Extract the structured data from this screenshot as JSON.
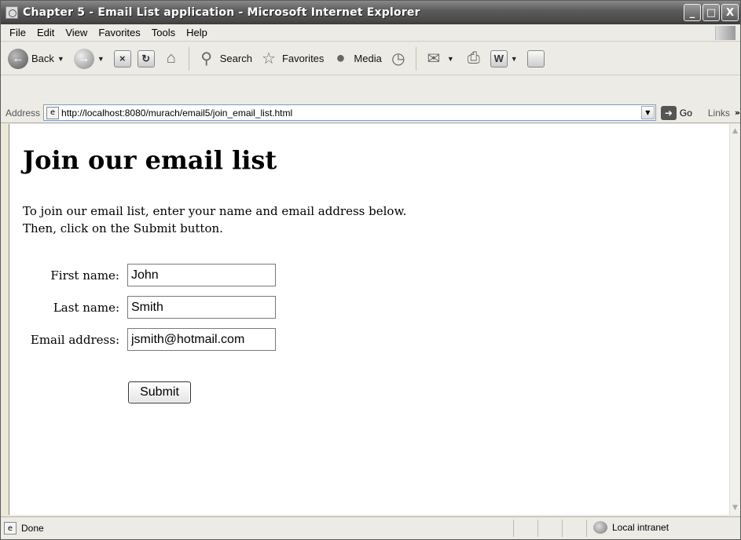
{
  "window": {
    "title": "Chapter 5 - Email List application - Microsoft Internet Explorer",
    "controls": {
      "minimize": "_",
      "maximize": "□",
      "close": "X"
    }
  },
  "menu": {
    "items": [
      {
        "label": "File"
      },
      {
        "label": "Edit"
      },
      {
        "label": "View"
      },
      {
        "label": "Favorites"
      },
      {
        "label": "Tools"
      },
      {
        "label": "Help"
      }
    ]
  },
  "toolbar": {
    "back_label": "Back",
    "search_label": "Search",
    "favorites_label": "Favorites",
    "media_label": "Media",
    "icons": {
      "back": "back-arrow-icon",
      "forward": "forward-arrow-icon",
      "stop": "stop-icon",
      "refresh": "refresh-icon",
      "home": "home-icon",
      "search": "search-icon",
      "favorites": "favorites-star-icon",
      "media": "media-icon",
      "history": "history-icon",
      "mail": "mail-icon",
      "print": "print-icon",
      "edit": "word-edit-icon",
      "discuss": "discuss-icon"
    }
  },
  "address": {
    "label": "Address",
    "url": "http://localhost:8080/murach/email5/join_email_list.html",
    "go_label": "Go",
    "links_label": "Links",
    "links_chevron": "»"
  },
  "page": {
    "title": "Join our email list",
    "intro_line1": "To join our email list, enter your name and email address below.",
    "intro_line2": "Then, click on the Submit button.",
    "form": {
      "first_name_label": "First name:",
      "first_name_value": "John",
      "last_name_label": "Last name:",
      "last_name_value": "Smith",
      "email_label": "Email address:",
      "email_value": "jsmith@hotmail.com",
      "submit_label": "Submit"
    }
  },
  "status": {
    "text": "Done",
    "zone": "Local intranet"
  },
  "colors": {
    "chrome": "#ecebe6",
    "titlebar": "#4a4a4a",
    "content_bg": "#ffffff"
  }
}
